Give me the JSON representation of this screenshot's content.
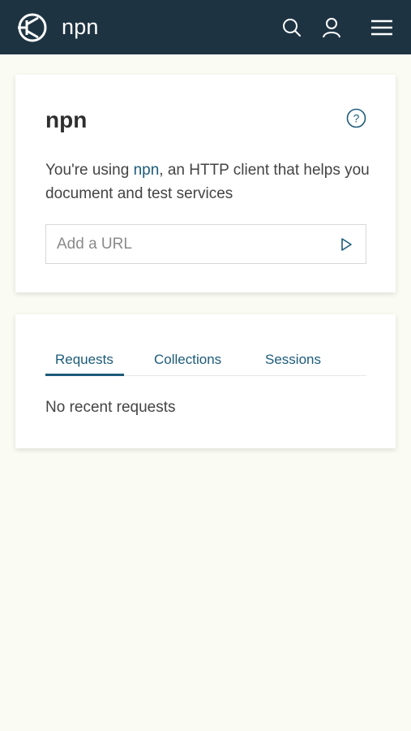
{
  "header": {
    "brand": "npn",
    "icons": {
      "logo": "npn-logo-icon",
      "search": "search-icon",
      "user": "user-icon",
      "menu": "hamburger-menu-icon"
    },
    "colors": {
      "background": "#1e3342",
      "foreground": "#ffffff"
    }
  },
  "intro_card": {
    "title": "npn",
    "help_icon": "help-circle-icon",
    "description_prefix": "You're using ",
    "description_link": "npn",
    "description_suffix": ", an HTTP client that helps you document and test services",
    "url_input": {
      "placeholder": "Add a URL",
      "value": ""
    },
    "send_icon": "play-send-icon",
    "accent_color": "#1c5b7a"
  },
  "history_card": {
    "tabs": [
      {
        "label": "Requests",
        "active": true
      },
      {
        "label": "Collections",
        "active": false
      },
      {
        "label": "Sessions",
        "active": false
      }
    ],
    "empty_message": "No recent requests"
  },
  "page": {
    "background": "#fafcf3"
  }
}
